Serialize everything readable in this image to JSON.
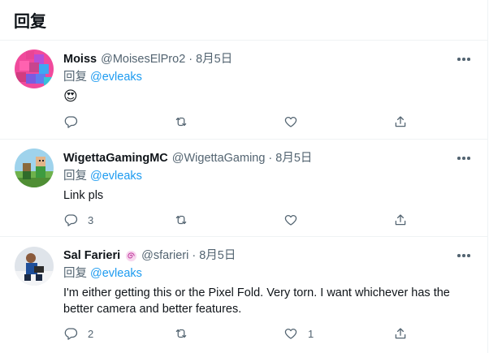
{
  "page": {
    "title": "回复"
  },
  "tweets": [
    {
      "name": "Moiss",
      "handle": "@MoisesElPro2",
      "separator": "·",
      "date": "8月5日",
      "reply_prefix": "回复",
      "reply_to": "@evleaks",
      "text": "😍",
      "counts": {
        "reply": "",
        "retweet": "",
        "like": ""
      }
    },
    {
      "name": "WigettaGamingMC",
      "handle": "@WigettaGaming",
      "separator": "·",
      "date": "8月5日",
      "reply_prefix": "回复",
      "reply_to": "@evleaks",
      "text": "Link pls",
      "counts": {
        "reply": "3",
        "retweet": "",
        "like": ""
      }
    },
    {
      "name": "Sal Farieri",
      "handle": "@sfarieri",
      "separator": "·",
      "date": "8月5日",
      "reply_prefix": "回复",
      "reply_to": "@evleaks",
      "text": "I'm either getting this or the Pixel Fold. Very torn. I want whichever has the better camera and better features.",
      "counts": {
        "reply": "2",
        "retweet": "",
        "like": "1"
      }
    }
  ],
  "icons": {
    "more": "more-horizontal-icon",
    "reply": "reply-bubble-icon",
    "retweet": "retweet-icon",
    "like": "heart-icon",
    "share": "share-upload-icon",
    "badge": "spiral-badge-icon"
  },
  "colors": {
    "accent": "#1d9bf0",
    "text": "#0f1419",
    "secondary": "#536471",
    "divider": "#eff3f4"
  }
}
